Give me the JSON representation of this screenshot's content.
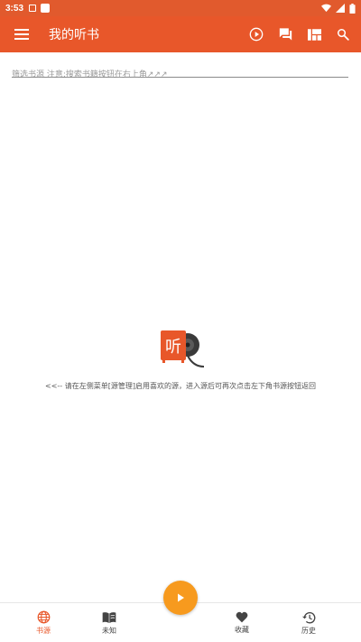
{
  "status_bar": {
    "time": "3:53"
  },
  "app_bar": {
    "title": "我的听书"
  },
  "filter": {
    "placeholder": "筛选书源 注意:搜索书籍按钮在右上角↗↗↗"
  },
  "empty_state": {
    "logo_text": "听",
    "message": "<<-- 请在左侧菜单[源管理]启用喜欢的源，进入源后可再次点击左下角书源按钮返回"
  },
  "bottom_nav": {
    "items": [
      {
        "label": "书源",
        "active": true
      },
      {
        "label": "未知",
        "active": false
      },
      {
        "label": "收藏",
        "active": false
      },
      {
        "label": "历史",
        "active": false
      }
    ]
  },
  "colors": {
    "primary": "#e8572a",
    "status_bar": "#e15a2d",
    "fab": "#f79a1e"
  },
  "icons": {
    "app_bar": [
      "menu-icon",
      "play-circle-icon",
      "forum-icon",
      "library-icon",
      "search-icon"
    ],
    "bottom_nav": [
      "globe-icon",
      "book-icon",
      "heart-icon",
      "history-icon"
    ],
    "fab": "play-icon"
  }
}
